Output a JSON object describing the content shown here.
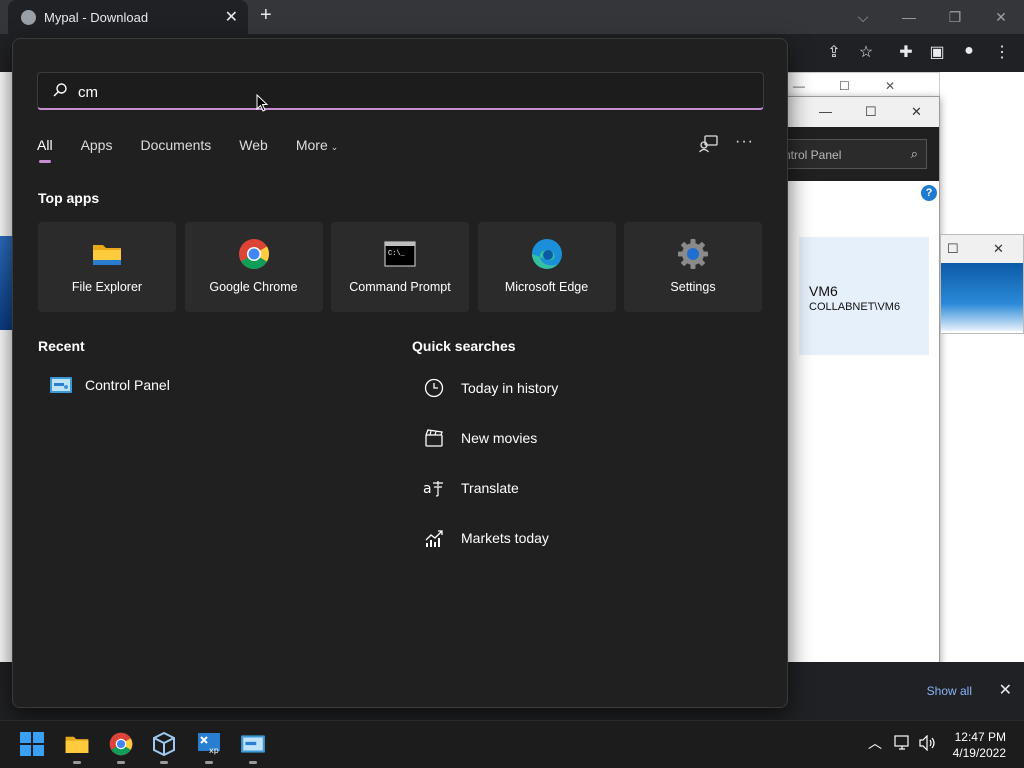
{
  "browser": {
    "tab_title": "Mypal - Download",
    "new_tab_label": "+",
    "close_tab_label": "✕",
    "download_bar": {
      "show_all_label": "Show all",
      "close_label": "✕"
    }
  },
  "control_panel": {
    "search_placeholder": "ntrol Panel",
    "user_name": "VM6",
    "user_account": "COLLABNET\\VM6",
    "help_label": "?"
  },
  "search_panel": {
    "query": "cm",
    "filter_tabs": [
      {
        "label": "All"
      },
      {
        "label": "Apps"
      },
      {
        "label": "Documents"
      },
      {
        "label": "Web"
      },
      {
        "label": "More"
      }
    ],
    "more_options_label": "···",
    "top_apps_title": "Top apps",
    "top_apps": [
      {
        "name": "File Explorer",
        "icon": "folder-icon"
      },
      {
        "name": "Google Chrome",
        "icon": "chrome-icon"
      },
      {
        "name": "Command Prompt",
        "icon": "cmd-icon"
      },
      {
        "name": "Microsoft Edge",
        "icon": "edge-icon"
      },
      {
        "name": "Settings",
        "icon": "gear-icon"
      }
    ],
    "recent_title": "Recent",
    "recent": [
      {
        "label": "Control Panel",
        "icon": "control-panel-icon"
      }
    ],
    "quick_searches_title": "Quick searches",
    "quick_searches": [
      {
        "label": "Today in history",
        "icon": "clock-icon"
      },
      {
        "label": "New movies",
        "icon": "clapperboard-icon"
      },
      {
        "label": "Translate",
        "icon": "translate-icon"
      },
      {
        "label": "Markets today",
        "icon": "chart-icon"
      }
    ]
  },
  "taskbar": {
    "apps": [
      "start-icon",
      "file-explorer-icon",
      "chrome-icon",
      "virtualbox-icon",
      "xp-mode-icon",
      "control-panel-icon"
    ],
    "time": "12:47 PM",
    "date": "4/19/2022"
  },
  "colors": {
    "panel_bg": "#202020",
    "tile_bg": "#2b2b2b",
    "accent": "#c78fd2"
  }
}
